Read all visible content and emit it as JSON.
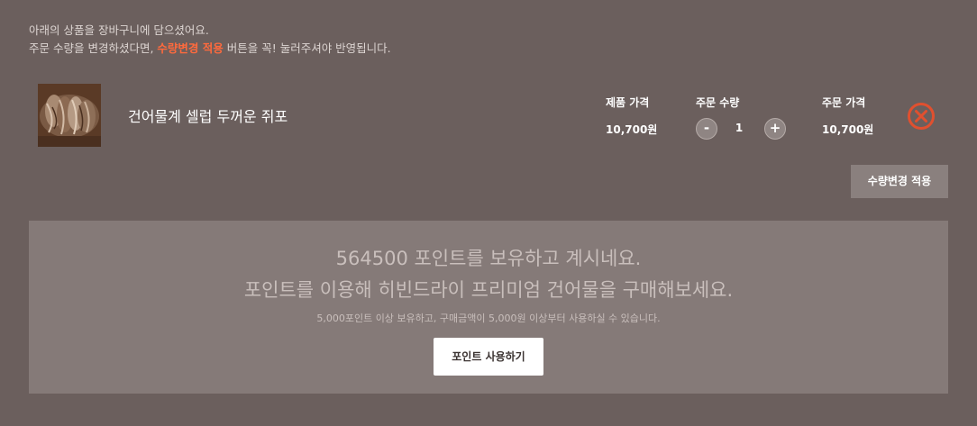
{
  "notice": {
    "line1": "아래의 상품을 장바구니에 담으셨어요.",
    "line2_before": "주문 수량을 변경하셨다면, ",
    "line2_highlight": "수량변경 적용",
    "line2_after": " 버튼을 꼭! 눌러주셔야 반영됩니다.",
    "highlight_color": "#ff6a3d"
  },
  "cart_item": {
    "image_icon": "dried-fish-photo",
    "name": "건어물계 셀럽 두꺼운 쥐포",
    "price_label": "제품 가격",
    "price_value": "10,700원",
    "qty_label": "주문 수량",
    "qty_minus": "-",
    "qty_value": "1",
    "qty_plus": "+",
    "total_label": "주문 가격",
    "total_value": "10,700원",
    "remove_icon": "close-circle-icon",
    "remove_color": "#e0502f"
  },
  "apply_button": {
    "label": "수량변경 적용"
  },
  "points": {
    "line1": "564500 포인트를 보유하고 계시네요.",
    "line2": "포인트를 이용해 히빈드라이 프리미엄 건어물을 구매해보세요.",
    "note": "5,000포인트 이상 보유하고, 구매금액이 5,000원 이상부터 사용하실 수 있습니다.",
    "button_label": "포인트 사용하기"
  }
}
